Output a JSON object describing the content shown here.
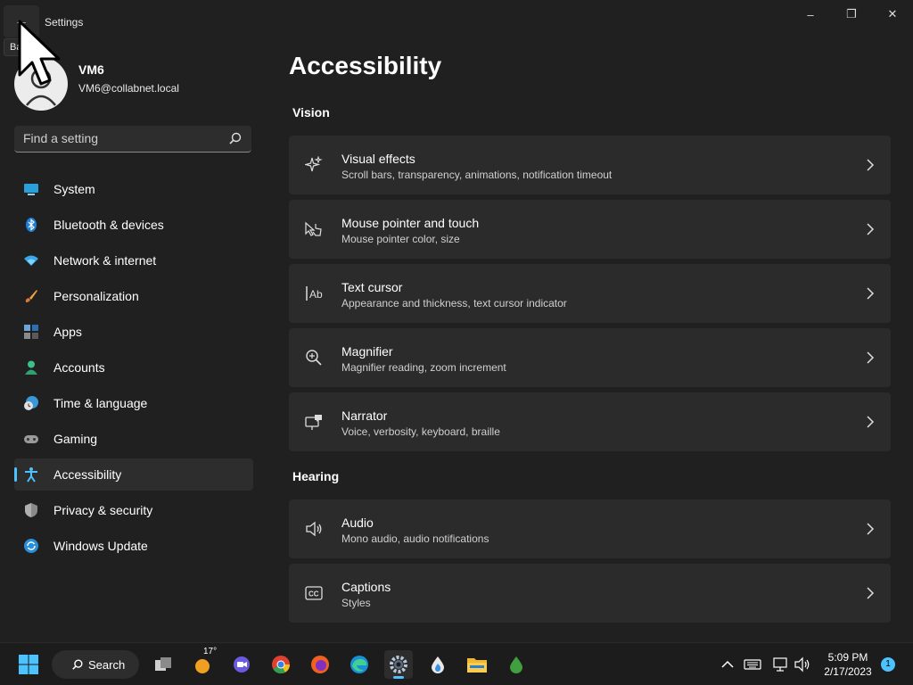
{
  "window": {
    "app_title": "Settings",
    "back_tooltip": "Ba",
    "controls": {
      "minimize": "–",
      "maximize": "❐",
      "close": "✕"
    }
  },
  "profile": {
    "name": "VM6",
    "email": "VM6@collabnet.local"
  },
  "search": {
    "placeholder": "Find a setting"
  },
  "nav": {
    "items": [
      {
        "label": "System",
        "icon": "system-icon"
      },
      {
        "label": "Bluetooth & devices",
        "icon": "bluetooth-icon"
      },
      {
        "label": "Network & internet",
        "icon": "network-icon"
      },
      {
        "label": "Personalization",
        "icon": "brush-icon"
      },
      {
        "label": "Apps",
        "icon": "apps-icon"
      },
      {
        "label": "Accounts",
        "icon": "accounts-icon"
      },
      {
        "label": "Time & language",
        "icon": "time-language-icon"
      },
      {
        "label": "Gaming",
        "icon": "gaming-icon"
      },
      {
        "label": "Accessibility",
        "icon": "accessibility-icon",
        "selected": true
      },
      {
        "label": "Privacy & security",
        "icon": "shield-icon"
      },
      {
        "label": "Windows Update",
        "icon": "update-icon"
      }
    ]
  },
  "main": {
    "title": "Accessibility",
    "sections": [
      {
        "title": "Vision",
        "cards": [
          {
            "title": "Visual effects",
            "desc": "Scroll bars, transparency, animations, notification timeout",
            "icon": "sparkle-icon"
          },
          {
            "title": "Mouse pointer and touch",
            "desc": "Mouse pointer color, size",
            "icon": "pointer-touch-icon"
          },
          {
            "title": "Text cursor",
            "desc": "Appearance and thickness, text cursor indicator",
            "icon": "text-cursor-icon"
          },
          {
            "title": "Magnifier",
            "desc": "Magnifier reading, zoom increment",
            "icon": "magnifier-icon"
          },
          {
            "title": "Narrator",
            "desc": "Voice, verbosity, keyboard, braille",
            "icon": "narrator-icon"
          }
        ]
      },
      {
        "title": "Hearing",
        "cards": [
          {
            "title": "Audio",
            "desc": "Mono audio, audio notifications",
            "icon": "speaker-icon"
          },
          {
            "title": "Captions",
            "desc": "Styles",
            "icon": "captions-icon"
          }
        ]
      }
    ]
  },
  "taskbar": {
    "search_label": "Search",
    "weather_temp": "17°",
    "time": "5:09 PM",
    "date": "2/17/2023",
    "notification_count": "1"
  },
  "colors": {
    "accent": "#4cc2ff",
    "background": "#202020",
    "card": "#2b2b2b"
  }
}
